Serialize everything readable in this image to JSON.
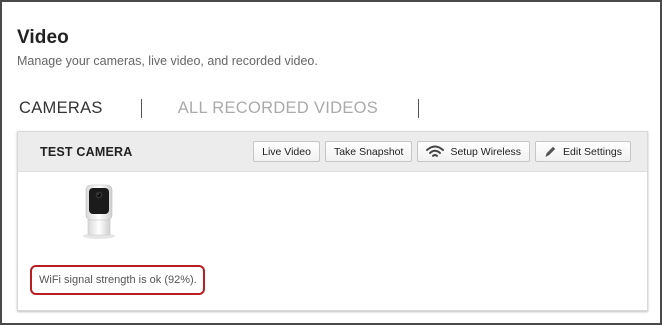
{
  "page": {
    "title": "Video",
    "subtitle": "Manage your cameras, live video, and recorded video."
  },
  "tabs": [
    {
      "label": "CAMERAS",
      "active": true
    },
    {
      "label": "ALL RECORDED VIDEOS",
      "active": false
    }
  ],
  "camera": {
    "name": "TEST CAMERA",
    "actions": {
      "live_video": "Live Video",
      "take_snapshot": "Take Snapshot",
      "setup_wireless": "Setup Wireless",
      "edit_settings": "Edit Settings"
    },
    "icons": {
      "setup_wireless": "wifi-icon",
      "edit_settings": "pencil-icon"
    },
    "wifi_status": "WiFi signal strength is ok (92%)."
  },
  "colors": {
    "highlight_border": "#b81e22",
    "card_header_bg": "#ececec"
  }
}
